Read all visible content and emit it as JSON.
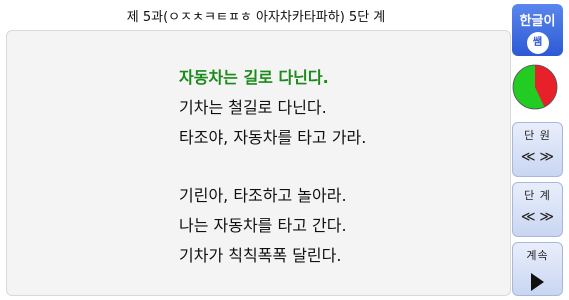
{
  "header": {
    "title": "제 5과(ㅇㅈㅊㅋㅌㅍㅎ 아자차카타파하) 5단 계"
  },
  "lesson": {
    "highlight": "자동차는 길로 다닌다.",
    "lines1": [
      "기차는 철길로 다닌다.",
      "타조야, 자동차를 타고 가라."
    ],
    "lines2": [
      "기린아, 타조하고 놀아라.",
      "나는 자동차를 타고 간다.",
      "기차가 칙칙폭폭 달린다."
    ]
  },
  "logo": {
    "text": "한글이",
    "seal_text": "쌤"
  },
  "progress": {
    "fraction_done": 0.43,
    "colors": {
      "done": "#e8202a",
      "remaining": "#22cc22"
    }
  },
  "unit_nav": {
    "label": "단 원",
    "prev": "≪",
    "next": "≫"
  },
  "step_nav": {
    "label": "단 계",
    "prev": "≪",
    "next": "≫"
  },
  "continue": {
    "label": "계속",
    "icon": "play-icon"
  }
}
